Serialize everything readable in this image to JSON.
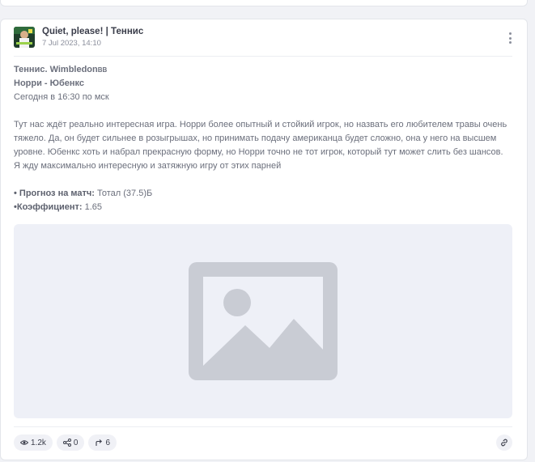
{
  "post": {
    "channel_name": "Quiet, please! | Теннис",
    "date": "7 Jul 2023, 14:10",
    "lines": {
      "sport": "Теннис. Wimbledon",
      "sport_suffix": "ВВ",
      "match": "Норри - Юбенкс",
      "time": "Сегодня в 16:30 по мск",
      "paragraph": "Тут нас ждёт реально интересная игра. Норри более опытный и стойкий игрок, но назвать его любителем травы очень тяжело. Да, он будет сильнее в розыгрышах, но принимать подачу американца будет сложно, она у него на высшем уровне. Юбенкс хоть и набрал прекрасную форму, но Норри точно не тот игрок, который тут может слить без шансов. Я жду максимально интересную и затяжную игру от этих парней",
      "forecast_label": "• Прогноз на матч:",
      "forecast_value": " Тотал (37.5)Б",
      "coef_label": "•Коэффициент:",
      "coef_value": " 1.65"
    },
    "media_icon": "image-placeholder-icon",
    "footer": {
      "views": "1.2k",
      "shares": "0",
      "forwards": "6"
    }
  },
  "colors": {
    "page_bg": "#f1f2f6",
    "card_bg": "#ffffff",
    "media_bg": "#eef0f7",
    "placeholder_icon": "#c9ccd4",
    "text": "#6b6f7c"
  }
}
